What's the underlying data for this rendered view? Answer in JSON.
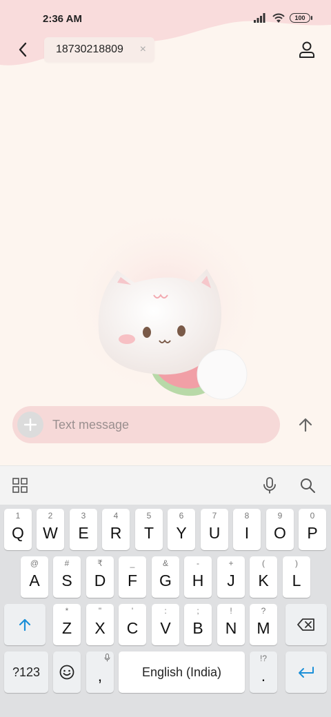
{
  "status_bar": {
    "time": "2:36 AM",
    "battery": "100",
    "icons": [
      "signal-icon",
      "wifi-icon",
      "battery-icon"
    ]
  },
  "header": {
    "recipient": "18730218809",
    "chip_close": "×",
    "icons": [
      "back-arrow-icon",
      "contact-icon"
    ]
  },
  "composer": {
    "placeholder": "Text message",
    "icons": [
      "plus-icon",
      "send-arrow-icon"
    ]
  },
  "keyboard_toolbar": {
    "icons": [
      "grid-icon",
      "mic-icon",
      "search-icon"
    ]
  },
  "keyboard": {
    "row1": [
      {
        "key": "Q",
        "hint": "1"
      },
      {
        "key": "W",
        "hint": "2"
      },
      {
        "key": "E",
        "hint": "3"
      },
      {
        "key": "R",
        "hint": "4"
      },
      {
        "key": "T",
        "hint": "5"
      },
      {
        "key": "Y",
        "hint": "6"
      },
      {
        "key": "U",
        "hint": "7"
      },
      {
        "key": "I",
        "hint": "8"
      },
      {
        "key": "O",
        "hint": "9"
      },
      {
        "key": "P",
        "hint": "0"
      }
    ],
    "row2": [
      {
        "key": "A",
        "hint": "@"
      },
      {
        "key": "S",
        "hint": "#"
      },
      {
        "key": "D",
        "hint": "₹"
      },
      {
        "key": "F",
        "hint": "_"
      },
      {
        "key": "G",
        "hint": "&"
      },
      {
        "key": "H",
        "hint": "-"
      },
      {
        "key": "J",
        "hint": "+"
      },
      {
        "key": "K",
        "hint": "("
      },
      {
        "key": "L",
        "hint": ")"
      }
    ],
    "row3": [
      {
        "key": "Z",
        "hint": "*"
      },
      {
        "key": "X",
        "hint": "\""
      },
      {
        "key": "C",
        "hint": "'"
      },
      {
        "key": "V",
        "hint": ":"
      },
      {
        "key": "B",
        "hint": ";"
      },
      {
        "key": "N",
        "hint": "!"
      },
      {
        "key": "M",
        "hint": "?"
      }
    ],
    "symbols_key": "?123",
    "comma_key": ",",
    "space_key": "English (India)",
    "period_key": ".",
    "period_hint": "!?",
    "accent_color": "#1a8fd8"
  },
  "colors": {
    "background": "#fdf5ef",
    "wave": "#f9dcdc",
    "composer": "#f6d9d8"
  }
}
